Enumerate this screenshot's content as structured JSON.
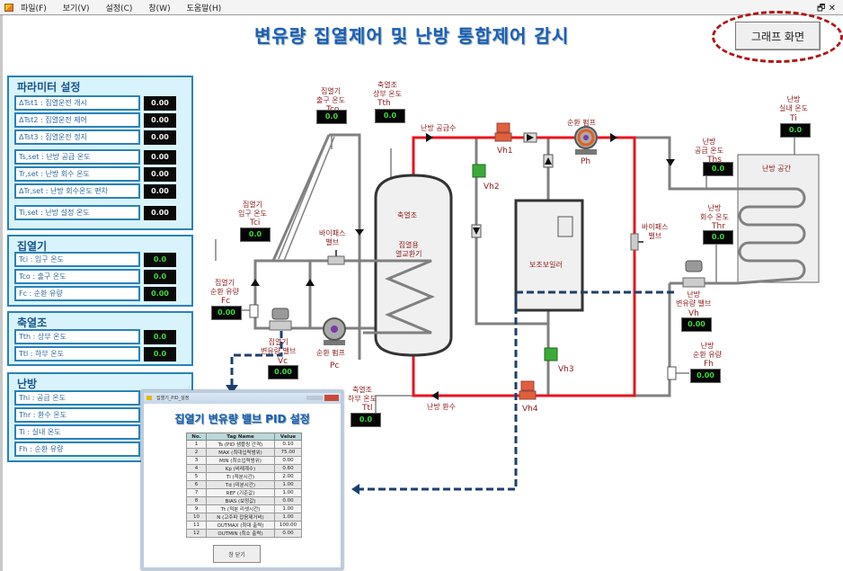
{
  "menu": {
    "items": [
      "파일(F)",
      "보기(V)",
      "설정(C)",
      "창(W)",
      "도움말(H)"
    ],
    "restore": "🗗",
    "close": "✕"
  },
  "title": "변유량 집열제어 및 난방 통합제어 감시",
  "graph_button": "그래프 화면",
  "param_panel": {
    "title": "파라미터 설정",
    "rows": [
      {
        "label": "ΔTst1 : 집열운전 개시",
        "value": "0.00"
      },
      {
        "label": "ΔTst2 : 집열운전 제어",
        "value": "0.00"
      },
      {
        "label": "ΔTst3 : 집열운전 정지",
        "value": "0.00"
      },
      {
        "label": "Ts,set   : 난방 공급 온도",
        "value": "0.00"
      },
      {
        "label": "Tr,set   : 난방 회수 온도",
        "value": "0.00"
      },
      {
        "label": "ΔTr,set : 난방 회수온도 편차",
        "value": "0.00"
      },
      {
        "label": "Ti,set : 난방 설정 온도",
        "value": "0.00"
      }
    ]
  },
  "collector_panel": {
    "title": "집열기",
    "rows": [
      {
        "label": "Tci : 입구 온도",
        "value": "0.0"
      },
      {
        "label": "Tco : 출구 온도",
        "value": "0.0"
      },
      {
        "label": "Fc   : 순환 유량",
        "value": "0.00"
      }
    ]
  },
  "storage_panel": {
    "title": "축열조",
    "rows": [
      {
        "label": "Tth : 상부 온도",
        "value": "0.0"
      },
      {
        "label": "Ttl : 하부 온도",
        "value": "0.0"
      }
    ]
  },
  "heating_panel": {
    "title": "난방",
    "rows": [
      {
        "label": "Thi  : 공급 온도",
        "value": ""
      },
      {
        "label": "Thr  : 환수 온도",
        "value": ""
      },
      {
        "label": "Ti    : 실내 온도",
        "value": ""
      },
      {
        "label": "Fh   : 순환 유량",
        "value": ""
      }
    ]
  },
  "diagram": {
    "tco": {
      "label": "집열기\n출구 온도",
      "tag": "Tco",
      "value": "0.0"
    },
    "tth": {
      "label": "축열조\n상부 온도",
      "tag": "Tth",
      "value": "0.0"
    },
    "tci": {
      "label": "집열기\n입구 온도",
      "tag": "Tci",
      "value": "0.0"
    },
    "fc": {
      "label": "집열기\n순환 유량",
      "tag": "Fc",
      "value": "0.00"
    },
    "vc": {
      "label": "집열기\n변유량 밸브",
      "tag": "Vc",
      "value": "0.00"
    },
    "pc": {
      "label": "순환 펌프",
      "tag": "Pc"
    },
    "bypass1": "바이패스\n밸브",
    "tank": "축열조",
    "hx": "집열용\n열교환기",
    "ttl": {
      "label": "축열조\n하부 온도",
      "tag": "Ttl",
      "value": "0.0"
    },
    "supply": "난방 공급수",
    "return": "난방 환수",
    "vh1": "Vh1",
    "vh2": "Vh2",
    "vh3": "Vh3",
    "vh4": "Vh4",
    "ph": {
      "label": "순환 펌프",
      "tag": "Ph"
    },
    "boiler": "보조보일러",
    "bypass2": "바이패스\n밸브",
    "ths": {
      "label": "난방\n공급 온도",
      "tag": "Ths",
      "value": "0.0"
    },
    "ti": {
      "label": "난방\n실내 온도",
      "tag": "Ti",
      "value": "0.0"
    },
    "room": "난방 공간",
    "thr": {
      "label": "난방\n회수 온도",
      "tag": "Thr",
      "value": "0.0"
    },
    "vh": {
      "label": "난방\n변유량 밸브",
      "tag": "Vh",
      "value": "0.00"
    },
    "fh": {
      "label": "난방\n순환 유량",
      "tag": "Fh",
      "value": "0.00"
    }
  },
  "pid_dialog": {
    "window_title": "집열기_PID_설정",
    "heading": "집열기 변유량 밸브 PID 설정",
    "columns": [
      "No.",
      "Tag Name",
      "Value"
    ],
    "rows": [
      [
        "1",
        "Ts (PID 샘플링 간격)",
        "0.10"
      ],
      [
        "2",
        "MAX (최대입력범위)",
        "75.00"
      ],
      [
        "3",
        "MIN (최소입력범위)",
        "0.00"
      ],
      [
        "4",
        "Kp (비례계수)",
        "0.60"
      ],
      [
        "5",
        "Ti (적분시간)",
        "2.00"
      ],
      [
        "6",
        "Td (미분시간)",
        "1.00"
      ],
      [
        "7",
        "REF (기준값)",
        "1.00"
      ],
      [
        "8",
        "BIAS (보정값)",
        "0.00"
      ],
      [
        "9",
        "Tt (적분 리셋시간)",
        "1.00"
      ],
      [
        "10",
        "N (고주파 잡음제거비)",
        "1.00"
      ],
      [
        "11",
        "OUTMAX (최대 출력)",
        "100.00"
      ],
      [
        "12",
        "OUTMIN (최소 출력)",
        "0.00"
      ]
    ],
    "close_button": "창 닫기"
  }
}
